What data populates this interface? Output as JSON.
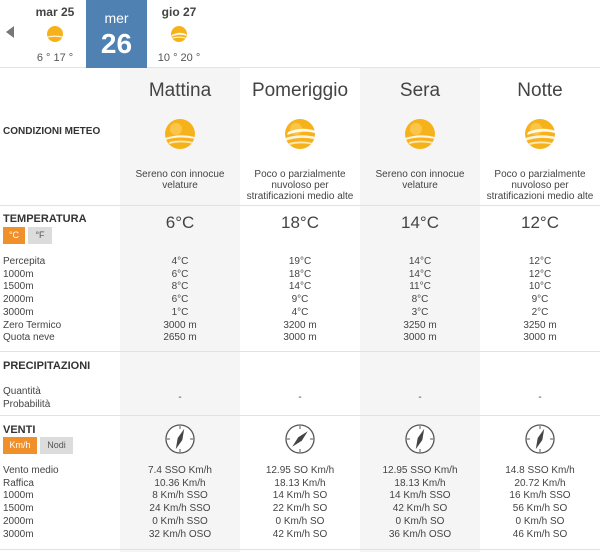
{
  "days": {
    "prev": {
      "label": "mar 25",
      "temps": "6 ° 17 °"
    },
    "current": {
      "weekday": "mer",
      "day": "26"
    },
    "next": {
      "label": "gio 27",
      "temps": "10 ° 20 °"
    }
  },
  "periods": [
    "Mattina",
    "Pomeriggio",
    "Sera",
    "Notte"
  ],
  "conditions": {
    "label": "CONDIZIONI METEO",
    "descriptions": [
      [
        "Sereno con innocue",
        "velature"
      ],
      [
        "Poco o parzialmente",
        "nuvoloso per",
        "stratificazioni medio alte"
      ],
      [
        "Sereno con innocue",
        "velature"
      ],
      [
        "Poco o parzialmente",
        "nuvoloso per",
        "stratificazioni medio alte"
      ]
    ],
    "icons": [
      "sun-veiled-icon",
      "sun-partly-cloudy-icon",
      "sun-veiled-icon",
      "sun-partly-cloudy-icon"
    ]
  },
  "temperature": {
    "title": "TEMPERATURA",
    "unit_c": "°C",
    "unit_f": "°F",
    "main": [
      "6°C",
      "18°C",
      "14°C",
      "12°C"
    ],
    "rows": [
      {
        "label": "Percepita",
        "values": [
          "4°C",
          "19°C",
          "14°C",
          "12°C"
        ]
      },
      {
        "label": "1000m",
        "values": [
          "6°C",
          "18°C",
          "14°C",
          "12°C"
        ]
      },
      {
        "label": "1500m",
        "values": [
          "8°C",
          "14°C",
          "11°C",
          "10°C"
        ]
      },
      {
        "label": "2000m",
        "values": [
          "6°C",
          "9°C",
          "8°C",
          "9°C"
        ]
      },
      {
        "label": "3000m",
        "values": [
          "1°C",
          "4°C",
          "3°C",
          "2°C"
        ]
      },
      {
        "label": "Zero Termico",
        "values": [
          "3000 m",
          "3200 m",
          "3250 m",
          "3250 m"
        ]
      },
      {
        "label": "Quota neve",
        "values": [
          "2650 m",
          "3000 m",
          "3000 m",
          "3000 m"
        ]
      }
    ]
  },
  "precipitation": {
    "title": "PRECIPITAZIONI",
    "rows": [
      {
        "label": "Quantità"
      },
      {
        "label": "Probabilità"
      }
    ],
    "values": [
      "-",
      "-",
      "-",
      "-"
    ]
  },
  "wind": {
    "title": "VENTI",
    "unit_kmh": "Km/h",
    "unit_knots": "Nodi",
    "rows": [
      {
        "label": "Vento medio",
        "values": [
          "7.4 SSO Km/h",
          "12.95 SO Km/h",
          "12.95 SSO Km/h",
          "14.8 SSO Km/h"
        ]
      },
      {
        "label": "Raffica",
        "values": [
          "10.36 Km/h",
          "18.13 Km/h",
          "18.13 Km/h",
          "20.72 Km/h"
        ]
      },
      {
        "label": "1000m",
        "values": [
          "8 Km/h SSO",
          "14 Km/h SO",
          "14 Km/h SSO",
          "16 Km/h SSO"
        ]
      },
      {
        "label": "1500m",
        "values": [
          "24 Km/h SSO",
          "22 Km/h SO",
          "42 Km/h SO",
          "56 Km/h SO"
        ]
      },
      {
        "label": "2000m",
        "values": [
          "0 Km/h SSO",
          "0 Km/h SO",
          "0 Km/h SO",
          "0 Km/h SO"
        ]
      },
      {
        "label": "3000m",
        "values": [
          "32 Km/h OSO",
          "42 Km/h SO",
          "36 Km/h OSO",
          "46 Km/h SO"
        ]
      }
    ],
    "directions_deg": [
      22.5,
      45,
      22.5,
      22.5
    ]
  },
  "colors": {
    "selected_day": "#4f81b3",
    "unit_active": "#f0902b",
    "unit_inactive": "#dcdcdc",
    "sun": "#f6b21b",
    "column_shade": "#f5f5f5"
  }
}
